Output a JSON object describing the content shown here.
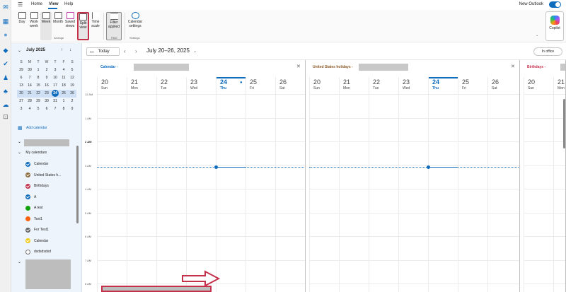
{
  "menubar": {
    "tabs": [
      "Home",
      "View",
      "Help"
    ],
    "active_tab": "View",
    "new_outlook_label": "New Outlook",
    "toggle_on": true
  },
  "ribbon": {
    "arrange": {
      "day": "Day",
      "work_week": "Work\nweek",
      "week": "Week",
      "month": "Month",
      "saved_views": "Saved\nviews",
      "split_view": "Split\nview",
      "time_scale": "Time\nscale",
      "group_label": "Arrange"
    },
    "filter": {
      "filter_applied": "Filter\napplied",
      "group_label": "Filter"
    },
    "settings": {
      "calendar_settings": "Calendar\nsettings",
      "group_label": "Settings"
    },
    "copilot_label": "Copilot"
  },
  "mini_calendar": {
    "month_label": "July 2025",
    "weekday_headers": [
      "S",
      "M",
      "T",
      "W",
      "T",
      "F",
      "S"
    ],
    "weeks": [
      [
        "29",
        "30",
        "1",
        "2",
        "3",
        "4",
        "5"
      ],
      [
        "6",
        "7",
        "8",
        "9",
        "10",
        "11",
        "12"
      ],
      [
        "13",
        "14",
        "15",
        "16",
        "17",
        "18",
        "19"
      ],
      [
        "20",
        "21",
        "22",
        "23",
        "24",
        "25",
        "26"
      ],
      [
        "27",
        "28",
        "29",
        "30",
        "31",
        "1",
        "2"
      ],
      [
        "3",
        "4",
        "5",
        "6",
        "7",
        "8",
        "9"
      ]
    ],
    "today": "24"
  },
  "sidebar": {
    "add_calendar": "Add calendar",
    "my_calendars": "My calendars",
    "calendars": [
      {
        "name": "Calendar",
        "color": "#0f6cbd",
        "checked": true
      },
      {
        "name": "United States h...",
        "color": "#8a6a3a",
        "checked": true
      },
      {
        "name": "Birthdays",
        "color": "#c4314b",
        "checked": true
      },
      {
        "name": "A",
        "color": "#0f6cbd",
        "checked": true
      },
      {
        "name": "A test",
        "color": "#13a10e",
        "checked": false
      },
      {
        "name": "Test1",
        "color": "#f7630c",
        "checked": false
      },
      {
        "name": "For Test1",
        "color": "#616161",
        "checked": true
      },
      {
        "name": "Calendar",
        "color": "#f2c811",
        "checked": true
      },
      {
        "name": "dsdsdsdsd",
        "color": "#ffffff",
        "checked": false
      }
    ]
  },
  "toolbar": {
    "today": "Today",
    "range": "July 20–26, 2025",
    "in_office": "In office"
  },
  "panes": [
    {
      "title": "Calendar - ",
      "title_color": "#0f6cbd"
    },
    {
      "title": "United States holidays - ",
      "title_color": "#8a5a2a"
    },
    {
      "title": "Birthdays - ",
      "title_color": "#c4314b"
    }
  ],
  "days": [
    {
      "num": "20",
      "dow": "Sun"
    },
    {
      "num": "21",
      "dow": "Mon"
    },
    {
      "num": "22",
      "dow": "Tue"
    },
    {
      "num": "23",
      "dow": "Wed"
    },
    {
      "num": "24",
      "dow": "Thu"
    },
    {
      "num": "25",
      "dow": "Fri"
    },
    {
      "num": "26",
      "dow": "Sat"
    }
  ],
  "time_labels": [
    "12 AM",
    "1 AM",
    "2 AM",
    "3 AM",
    "4 AM",
    "5 AM",
    "6 AM",
    "7 AM",
    "8 AM"
  ]
}
